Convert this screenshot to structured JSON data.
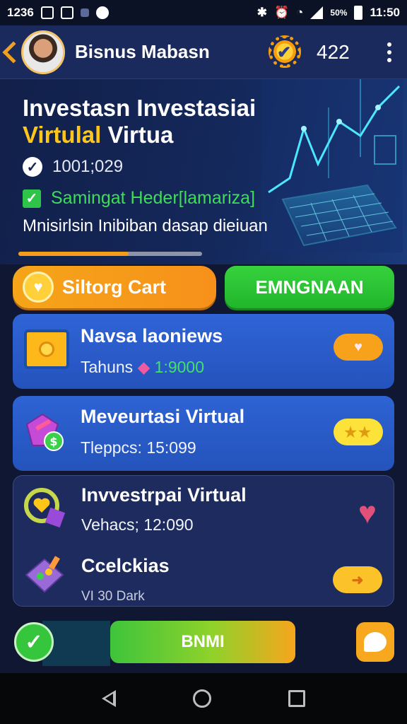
{
  "status_bar": {
    "time_left": "1236",
    "battery_percent": "50%",
    "clock": "11:50"
  },
  "header": {
    "title": "Bisnus Mabasn",
    "coins": "422"
  },
  "hero": {
    "title_line1": "Investasn Investasiai",
    "title_line2_highlight": "Virtulal",
    "title_line2_rest": "Virtua",
    "timer": "1001;029",
    "status_green": "Samingat Heder[lamariza]",
    "description": "Mnisirlsin Inibiban dasap dieiuan",
    "progress": 0.6
  },
  "actions": {
    "cart_label": "Siltorg Cart",
    "green_label": "EMNGNAAN"
  },
  "cards": [
    {
      "title": "Navsa laoniews",
      "sub_label": "Tahuns",
      "sub_value": "1:9000"
    },
    {
      "title": "Meveurtasi Virtual",
      "sub": "Tleppcs: 15:099"
    },
    {
      "title": "Invvestrpai Virtual",
      "sub": "Vehacs; 12:090"
    },
    {
      "title": "Ccelckias",
      "sub": "VI 30 Dark"
    }
  ],
  "bottom": {
    "main_label": "BNMI"
  },
  "colors": {
    "accent_orange": "#f7901a",
    "accent_green": "#21b52b",
    "card_blue": "#2553bd",
    "highlight_yellow": "#ffc61a"
  }
}
